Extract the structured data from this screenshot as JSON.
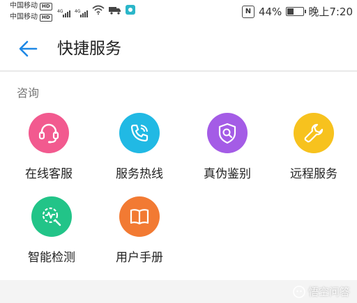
{
  "status_bar": {
    "carrier_1": "中国移动",
    "carrier_2": "中国移动",
    "hd_badge": "HD",
    "network_1": "4G",
    "network_2": "4G",
    "battery_percent": "44%",
    "battery_level": 0.44,
    "time": "晚上7:20",
    "icons": [
      "nfc-icon",
      "wifi-icon",
      "delivery-truck-icon",
      "app-notification-icon",
      "battery-icon"
    ]
  },
  "header": {
    "back_icon": "back-arrow-icon",
    "title": "快捷服务"
  },
  "section": {
    "label": "咨询"
  },
  "services": [
    {
      "label": "在线客服",
      "icon": "headset-icon",
      "color": "#f25a8f"
    },
    {
      "label": "服务热线",
      "icon": "phone-icon",
      "color": "#21b9e4"
    },
    {
      "label": "真伪鉴别",
      "icon": "shield-search-icon",
      "color": "#a45ce6"
    },
    {
      "label": "远程服务",
      "icon": "wrench-icon",
      "color": "#f7c21e"
    },
    {
      "label": "智能检测",
      "icon": "smart-detect-icon",
      "color": "#22c488"
    },
    {
      "label": "用户手册",
      "icon": "manual-book-icon",
      "color": "#f27a33"
    }
  ],
  "watermark": {
    "text": "悟空问答"
  },
  "colors": {
    "accent": "#1e88e5",
    "background": "#ffffff",
    "divider": "#e9e9e9"
  }
}
